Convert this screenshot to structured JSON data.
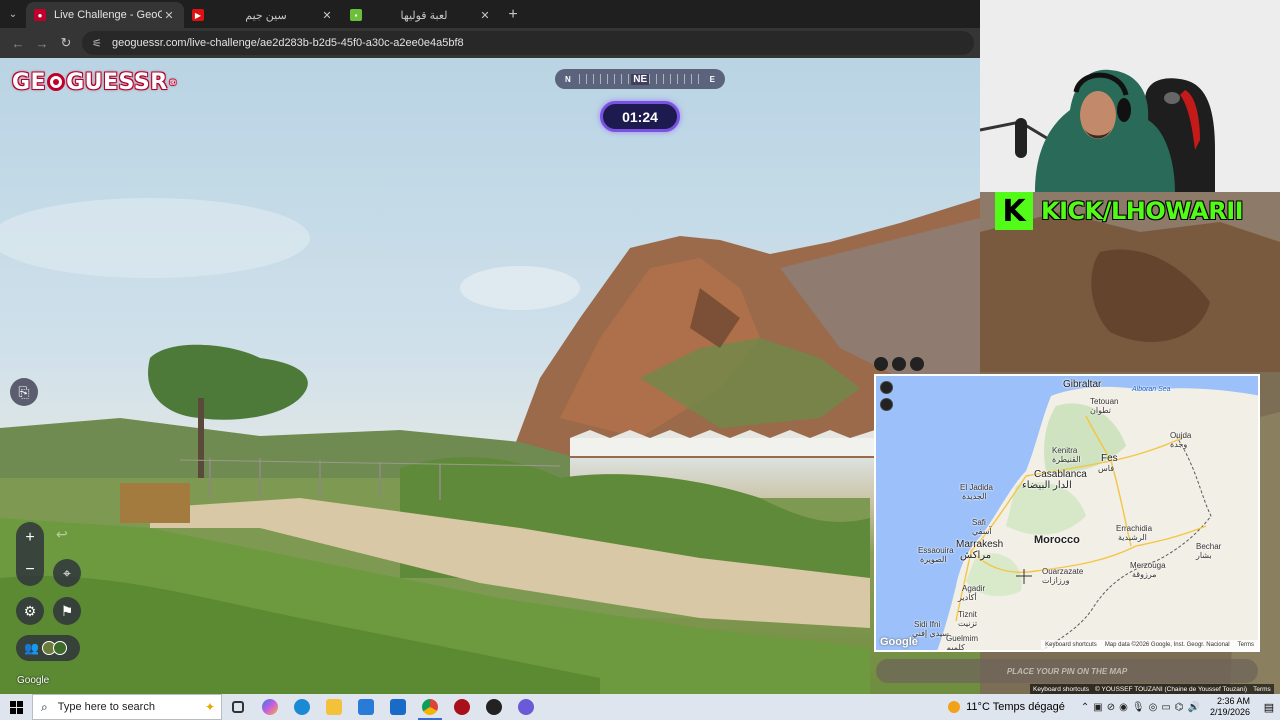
{
  "browser": {
    "tabs": [
      {
        "title": "Live Challenge - GeoGuessr",
        "active": true,
        "favicon_color": "#c0002a"
      },
      {
        "title": "سين جيم",
        "active": false,
        "favicon_color": "#d11"
      },
      {
        "title": "لعبة قوليها",
        "active": false,
        "favicon_color": "#6cbf3a"
      }
    ],
    "new_tab": "+",
    "url": "geoguessr.com/live-challenge/ae2d283b-b2d5-45f0-a30c-a2ee0e4a5bf8"
  },
  "game": {
    "logo_left": "GE",
    "logo_right": "GUESSR",
    "logo_reg": "®",
    "compass": {
      "left": "N",
      "center": "NE",
      "right": "E"
    },
    "timer": "01:24",
    "zoom_in": "+",
    "zoom_out": "−",
    "undo": "↩",
    "google_attribution": "Google",
    "place_pin": "PLACE YOUR PIN ON THE MAP",
    "bottom_credits": [
      "Keyboard shortcuts",
      "© YOUSSEF TOUZANI (Chaine de Youssef Touzani)",
      "Terms"
    ]
  },
  "stream": {
    "kick_logo": "K",
    "kick_text": "KICK/LHOWARII"
  },
  "map": {
    "labels": {
      "gibraltar": "Gibraltar",
      "alboran": "Alboran Sea",
      "tetouan": "Tetouan",
      "tetouan_ar": "تطوان",
      "oujda": "Oujda",
      "oujda_ar": "وجدة",
      "kenitra": "Kenitra",
      "kenitra_ar": "القنيطرة",
      "fes": "Fes",
      "fes_ar": "فاس",
      "casablanca": "Casablanca",
      "casablanca_ar": "الدار البيضاء",
      "eljadida": "El Jadida",
      "eljadida_ar": "الجديدة",
      "safi": "Safi",
      "safi_ar": "آسفي",
      "morocco": "Morocco",
      "marrakesh": "Marrakesh",
      "marrakesh_ar": "مراكش",
      "essaouira": "Essaouira",
      "essaouira_ar": "الصويرة",
      "errachidia": "Errachidia",
      "errachidia_ar": "الرشيدية",
      "bechar": "Bechar",
      "bechar_ar": "بشار",
      "ouarzazate": "Ouarzazate",
      "ouarzazate_ar": "ورزازات",
      "merzouga": "Merzouga",
      "merzouga_ar": "مرزوقة",
      "agadir": "Agadir",
      "agadir_ar": "أكادير",
      "tiznit": "Tiznit",
      "tiznit_ar": "تزنيت",
      "sidiifni": "Sidi Ifni",
      "sidiifni_ar": "سيدي إفني",
      "guelmim": "Guelmim",
      "guelmim_ar": "كلميم"
    },
    "google": "Google",
    "footer": [
      "Keyboard shortcuts",
      "Map data ©2026 Google, Inst. Geogr. Nacional",
      "Terms"
    ]
  },
  "taskbar": {
    "search_placeholder": "Type here to search",
    "weather": "11°C  Temps dégagé",
    "time": "2:36 AM",
    "date": "2/19/2026"
  },
  "colors": {
    "geoguessr_red": "#c0002a",
    "timer_border": "#7b52e0",
    "kick_green": "#53fc18",
    "map_water": "#9cc0f9"
  }
}
